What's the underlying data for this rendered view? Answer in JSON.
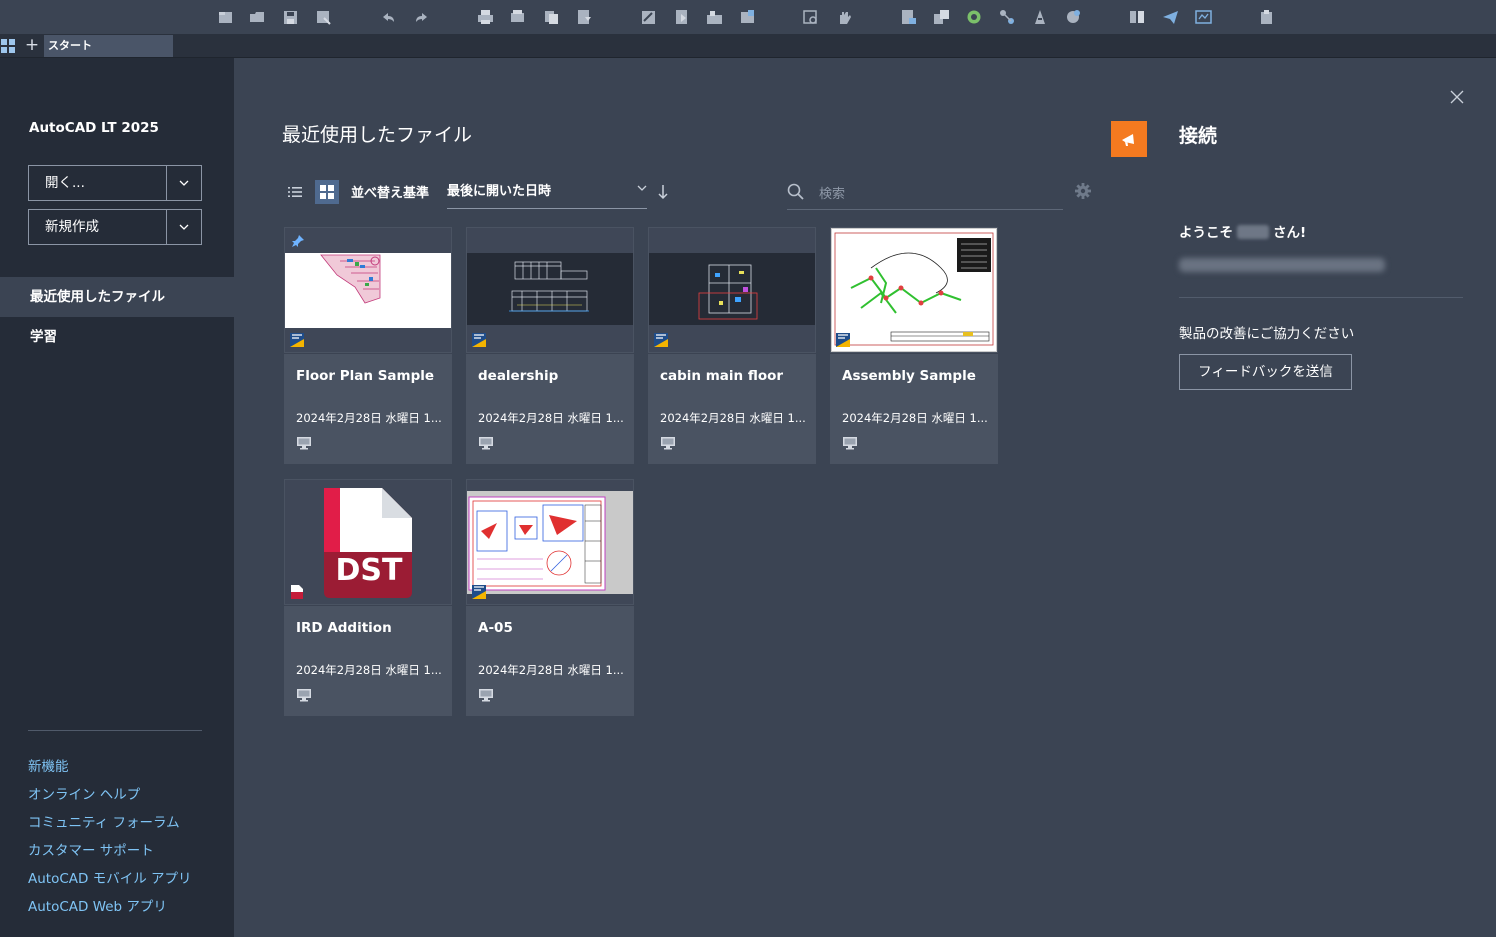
{
  "toolbar": {
    "icons": [
      "new-file-icon",
      "open-file-icon",
      "save-icon",
      "save-as-icon",
      "undo-icon",
      "redo-icon",
      "plot-icon",
      "batch-plot-icon",
      "publish-icon",
      "pdf-import-icon",
      "sheet-set-icon",
      "insert-block-icon",
      "xref-icon",
      "layer-icon",
      "zoom-window-icon",
      "pan-icon",
      "properties-icon",
      "design-center-icon",
      "tool-palette-icon",
      "markup-icon",
      "calculator-icon",
      "compare-icon",
      "block-editor-icon",
      "share-icon",
      "send-icon",
      "viewer-icon",
      "paste-icon"
    ]
  },
  "tabbar": {
    "add_label": "+",
    "start_tab": "スタート"
  },
  "sidebar": {
    "app_title": "AutoCAD LT 2025",
    "open_label": "開く...",
    "new_label": "新規作成",
    "nav": [
      {
        "label": "最近使用したファイル",
        "active": true
      },
      {
        "label": "学習",
        "active": false
      }
    ],
    "links": [
      "新機能",
      "オンライン ヘルプ",
      "コミュニティ フォーラム",
      "カスタマー サポート",
      "AutoCAD モバイル アプリ",
      "AutoCAD Web アプリ"
    ]
  },
  "main": {
    "title": "最近使用したファイル",
    "sort_label": "並べ替え基準",
    "sort_value": "最後に開いた日時",
    "search_placeholder": "検索",
    "files": [
      {
        "name": "Floor Plan Sample",
        "date": "2024年2月28日 水曜日 1...",
        "pinned": true,
        "type": "dwg"
      },
      {
        "name": "dealership",
        "date": "2024年2月28日 水曜日 1...",
        "pinned": false,
        "type": "dwg"
      },
      {
        "name": "cabin main floor",
        "date": "2024年2月28日 水曜日 1...",
        "pinned": false,
        "type": "dwg"
      },
      {
        "name": "Assembly Sample",
        "date": "2024年2月28日 水曜日 1...",
        "pinned": false,
        "type": "dwg"
      },
      {
        "name": "IRD Addition",
        "date": "2024年2月28日 水曜日 1...",
        "pinned": false,
        "type": "dst"
      },
      {
        "name": "A-05",
        "date": "2024年2月28日 水曜日 1...",
        "pinned": false,
        "type": "dwg"
      }
    ],
    "dst_label": "DST"
  },
  "right_panel": {
    "title": "接続",
    "welcome_prefix": "ようこそ",
    "welcome_suffix": "さん!",
    "improve_text": "製品の改善にご協力ください",
    "feedback_button": "フィードバックを送信"
  },
  "colors": {
    "accent": "#f47a20",
    "link": "#7fc4f5",
    "sidebar_bg": "#252c38",
    "main_bg": "#3b4453",
    "card_bg": "#4a5362"
  }
}
